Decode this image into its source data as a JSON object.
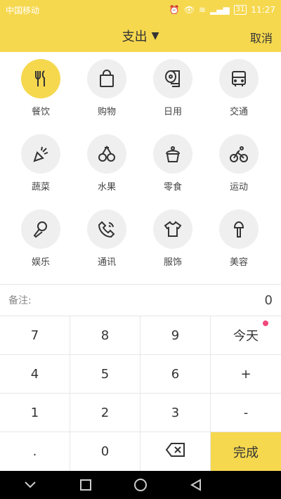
{
  "statusbar": {
    "carrier": "中国移动",
    "time": "11:27",
    "battery": "31"
  },
  "header": {
    "title": "支出",
    "cancel": "取消"
  },
  "categories": [
    {
      "label": "餐饮",
      "icon": "utensils-icon"
    },
    {
      "label": "购物",
      "icon": "shopping-bag-icon"
    },
    {
      "label": "日用",
      "icon": "toilet-paper-icon"
    },
    {
      "label": "交通",
      "icon": "bus-icon"
    },
    {
      "label": "蔬菜",
      "icon": "carrot-icon"
    },
    {
      "label": "水果",
      "icon": "cherry-icon"
    },
    {
      "label": "零食",
      "icon": "cupcake-icon"
    },
    {
      "label": "运动",
      "icon": "cycling-icon"
    },
    {
      "label": "娱乐",
      "icon": "microphone-icon"
    },
    {
      "label": "通讯",
      "icon": "phone-icon"
    },
    {
      "label": "服饰",
      "icon": "tshirt-icon"
    },
    {
      "label": "美容",
      "icon": "brush-icon"
    }
  ],
  "memo": {
    "label": "备注:",
    "amount": "0"
  },
  "keypad": {
    "k7": "7",
    "k8": "8",
    "k9": "9",
    "today": "今天",
    "k4": "4",
    "k5": "5",
    "k6": "6",
    "plus": "+",
    "k1": "1",
    "k2": "2",
    "k3": "3",
    "minus": "-",
    "dot": ".",
    "k0": "0",
    "done": "完成"
  },
  "colors": {
    "accent": "#f6d84f",
    "badge": "#f0487a"
  }
}
